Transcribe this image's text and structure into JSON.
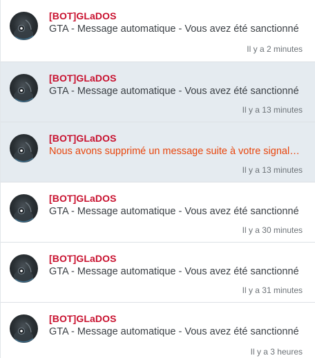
{
  "notifications": [
    {
      "sender": "[BOT]GLaDOS",
      "message": "GTA - Message automatique - Vous avez été sanctionné",
      "time": "Il y a 2 minutes",
      "unread": false,
      "alert": false
    },
    {
      "sender": "[BOT]GLaDOS",
      "message": "GTA - Message automatique - Vous avez été sanctionné",
      "time": "Il y a 13 minutes",
      "unread": true,
      "alert": false
    },
    {
      "sender": "[BOT]GLaDOS",
      "message": "Nous avons supprimé un message suite à votre signalement",
      "time": "Il y a 13 minutes",
      "unread": true,
      "alert": true
    },
    {
      "sender": "[BOT]GLaDOS",
      "message": "GTA - Message automatique - Vous avez été sanctionné",
      "time": "Il y a 30 minutes",
      "unread": false,
      "alert": false
    },
    {
      "sender": "[BOT]GLaDOS",
      "message": "GTA - Message automatique - Vous avez été sanctionné",
      "time": "Il y a 31 minutes",
      "unread": false,
      "alert": false
    },
    {
      "sender": "[BOT]GLaDOS",
      "message": "GTA - Message automatique - Vous avez été sanctionné",
      "time": "Il y a 3 heures",
      "unread": false,
      "alert": false
    }
  ],
  "colors": {
    "sender": "#c8102e",
    "alert_message": "#e8450c",
    "unread_background": "#e5ebf0",
    "read_background": "#ffffff"
  },
  "avatar_icon": "glados-avatar-icon"
}
